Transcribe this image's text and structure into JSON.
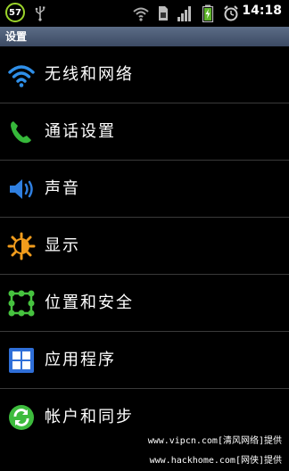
{
  "status_bar": {
    "battery_level": "57",
    "time": "14:18",
    "icons": [
      "battery-level-icon",
      "usb-icon",
      "wifi-icon",
      "sim-icon",
      "signal-icon",
      "battery-charging-icon",
      "alarm-icon"
    ]
  },
  "header": {
    "title": "设置"
  },
  "settings": {
    "items": [
      {
        "label": "无线和网络",
        "icon": "wifi-icon"
      },
      {
        "label": "通话设置",
        "icon": "phone-icon"
      },
      {
        "label": "声音",
        "icon": "speaker-icon"
      },
      {
        "label": "显示",
        "icon": "brightness-icon"
      },
      {
        "label": "位置和安全",
        "icon": "location-security-icon"
      },
      {
        "label": "应用程序",
        "icon": "apps-icon"
      },
      {
        "label": "帐户和同步",
        "icon": "sync-icon"
      }
    ]
  },
  "watermark": {
    "line1": "www.vipcn.com[清风网络]提供",
    "line2": "www.hackhome.com[网侠]提供"
  },
  "colors": {
    "title_bar": "#4a5870",
    "accent_green": "#3dbb3d",
    "accent_blue": "#2f7fe0",
    "battery_green": "#9bd32a"
  }
}
